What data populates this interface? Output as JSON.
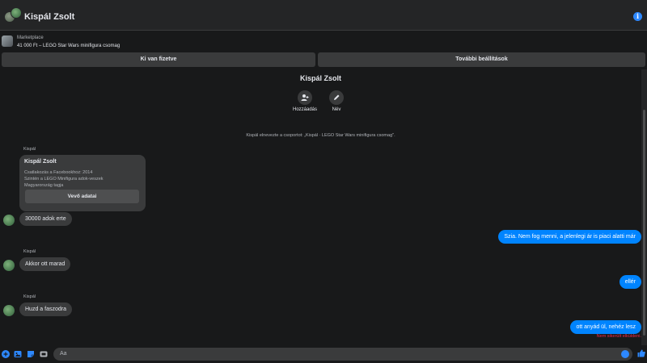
{
  "header": {
    "title": "Kispál Zsolt",
    "info_icon": "info-icon",
    "info_glyph": "i"
  },
  "marketplace": {
    "label": "Marketplace",
    "listing": "41 000 Ft – LEGO Star Wars minifigura csomag"
  },
  "actions": {
    "paid_label": "Ki van fizetve",
    "more_settings_label": "További beállítások"
  },
  "conversation": {
    "name": "Kispál Zsolt",
    "add_label": "Hozzáadás",
    "name_label": "Név",
    "system_message": "Kispál elnevezte a csoportot: „Kispál · LEGO Star Wars minifigura csomag\"."
  },
  "profile_card": {
    "sender": "Kispál",
    "name": "Kispál Zsolt",
    "lines": [
      "Csatlakozás a Facebookhoz: 2014",
      "Szintén a LEGO Minifigura adok-veszek",
      "Magyarország tagja"
    ],
    "button_label": "Vevő adatai"
  },
  "messages": [
    {
      "dir": "in",
      "sender": "",
      "text": "30000 adok erte"
    },
    {
      "dir": "out",
      "text": "Szia. Nem fog menni, a jelenlegi ár is piaci alatti már"
    },
    {
      "dir": "in",
      "sender": "Kispál",
      "text": "Akkor ott marad"
    },
    {
      "dir": "out",
      "text": "ellér"
    },
    {
      "dir": "in",
      "sender": "Kispál",
      "text": "Huzd a faszodra"
    },
    {
      "dir": "out",
      "text": "ott anyád ül, nehéz lesz"
    }
  ],
  "error_text": "Nem sikerült elküldeni.",
  "composer": {
    "placeholder": "Aa"
  },
  "colors": {
    "background": "#18191a",
    "surface": "#242526",
    "bubble_in": "#3a3b3c",
    "bubble_out": "#0084ff",
    "accent": "#2d88ff",
    "error": "#f02849"
  }
}
